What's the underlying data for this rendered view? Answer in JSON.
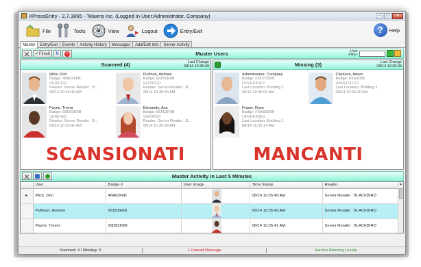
{
  "window": {
    "title": "XPressEntry - 2.7.3865 - Telaeris Inc. (Logged In User:Administrator, Company)",
    "minimize": "–",
    "maximize": "▭",
    "close": "✕"
  },
  "toolbar": {
    "file": "File",
    "tools": "Tools",
    "view": "View",
    "logout": "Logout",
    "entry_exit": "Entry/Exit",
    "help": "Help",
    "help_glyph": "?"
  },
  "tabs": [
    "Muster",
    "Entry/Exit",
    "Events",
    "Activity History",
    "Messages",
    "Add/Edit Info",
    "Server Activity"
  ],
  "muster_users": {
    "title": "Muster Users",
    "finish_label": "Finish",
    "filter_label_1": "User",
    "filter_label_2": "Filter:",
    "filter_value": ""
  },
  "scanned": {
    "title": "Scanned (4)",
    "last_change_label": "Last Change",
    "last_change_value": "08/14 10:35:49",
    "people": [
      {
        "name": "Wick, Don",
        "badge": "Badge: 46A02F6B",
        "status": "VERIFIED",
        "reader": "Reader: Server Reader : B...",
        "time": "08/14 10:35:49 AM"
      },
      {
        "name": "Pullman, Andrew",
        "badge": "Badge: 561B2E6B",
        "status": "VERIFIED",
        "reader": "Reader: Server Reader : B...",
        "time": "08/14 10:35:43 AM"
      },
      {
        "name": "Payne, Trevor",
        "badge": "Badge: 56D82D6B",
        "status": "VERIFIED",
        "reader": "Reader: Server Reader : B...",
        "time": "08/14 10:35:41 AM"
      },
      {
        "name": "Edmunds, Ava",
        "badge": "Badge: 06A02F6B",
        "status": "VERIFIED",
        "reader": "Reader: Server Reader : B...",
        "time": "08/14 10:35:38 AM"
      }
    ],
    "overlay": "SCANSIONATI"
  },
  "missing": {
    "title": "Missing (3)",
    "last_change_label": "Last Change",
    "last_change_value": "08/14 10:36:06",
    "people": [
      {
        "name": "Administrator, Company",
        "badge": "Badge: F6C72D6B",
        "status": "UNVERIFIED",
        "location": "Last Location: Building 1",
        "time": "08/14 10:36:06 AM"
      },
      {
        "name": "Clarkson, Adam",
        "badge": "Badge: E65426B",
        "status": "UNVERIFIED",
        "location": "Last Location: Building 2",
        "time": "08/14 10:35:20 AM"
      },
      {
        "name": "Fraser, Rose",
        "badge": "Badge: F6AB2E6B",
        "status": "UNVERIFIED",
        "location": "Last Location: Building 1",
        "time": "08/14 10:35:14 AM"
      }
    ],
    "overlay": "MANCANTI"
  },
  "activity": {
    "title": "Muster Activity in Last 5 Minutes",
    "columns": [
      "User",
      "Badge #",
      "User Image",
      "Time Stamp",
      "Reader"
    ],
    "rows": [
      {
        "user": "Wick, Don",
        "badge": "46A02F6B",
        "time": "08/14 10:35:49 AM",
        "reader": "Server Reader : BLACKBIRD",
        "current": "▸"
      },
      {
        "user": "Pullman, Andrew",
        "badge": "561B2E6B",
        "time": "08/14 10:35:43 AM",
        "reader": "Server Reader : BLACKBIRD",
        "current": ""
      },
      {
        "user": "Payne, Trevor",
        "badge": "56D82D6B",
        "time": "08/14 10:35:41 AM",
        "reader": "Server Reader : BLACKBIRD",
        "current": ""
      }
    ]
  },
  "status": {
    "counts": "Scanned: 4 / Missing: 3",
    "messages": "1 Unread Message",
    "server": "Service Running Locally"
  },
  "colors": {
    "accent_header": "#8ff3dc",
    "highlight_row": "#b6f0f6",
    "overlay_text": "#d9342b",
    "unread": "#d42020",
    "service_ok": "#2e8a2e"
  }
}
